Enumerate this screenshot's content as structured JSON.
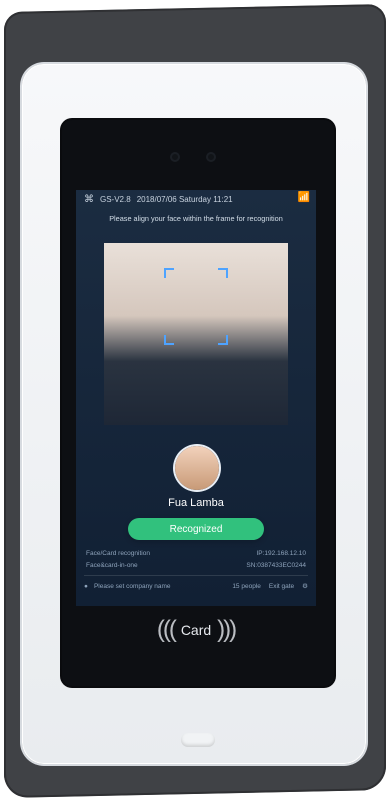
{
  "status": {
    "version": "GS-V2.8",
    "datetime": "2018/07/06 Saturday 11:21",
    "wifi_icon": "wifi-icon",
    "app_icon": "app-icon"
  },
  "instruction": "Please align your face within the frame for recognition",
  "person": {
    "name": "Fua Lamba"
  },
  "result": {
    "label": "Recognized"
  },
  "info": {
    "left1": "Face/Card recognition",
    "right1": "IP:192.168.12.10",
    "left2": "Face&card-in-one",
    "right2": "SN:0387433EC0244"
  },
  "footer": {
    "company": "Please set company name",
    "people": "15 people",
    "exit": "Exit gate"
  },
  "card": {
    "label": "Card"
  },
  "colors": {
    "accent": "#31c17d",
    "bracket": "#4ea3ff",
    "screen_bg": "#162437"
  }
}
